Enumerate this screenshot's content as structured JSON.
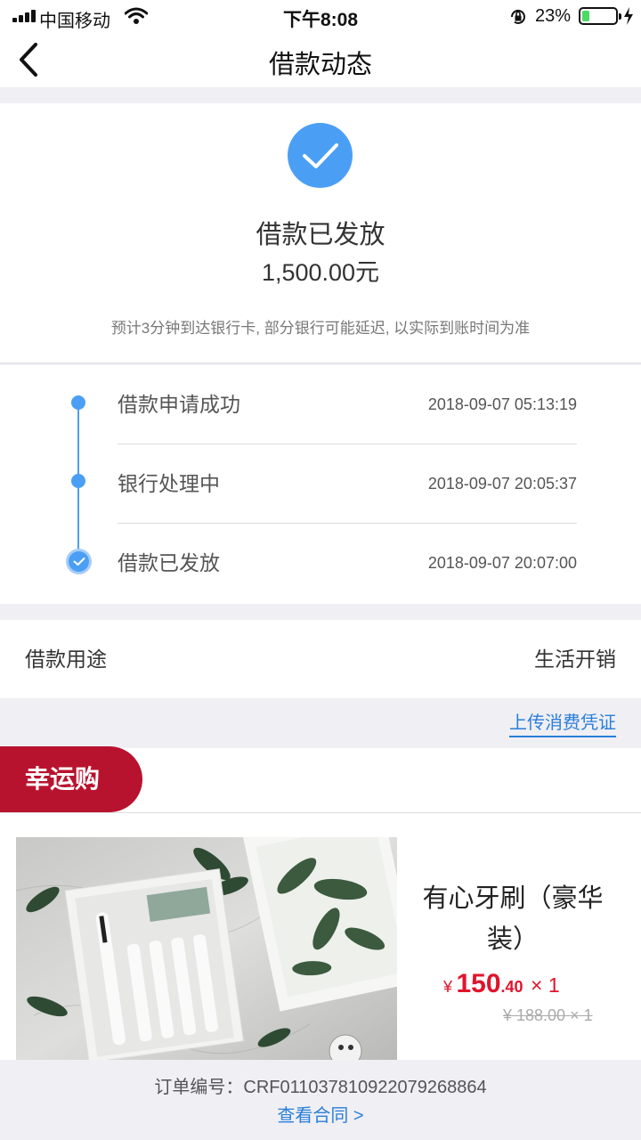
{
  "status_bar": {
    "carrier": "中国移动",
    "time": "下午8:08",
    "battery_percent": "23%",
    "battery_level": 0.23,
    "icons": [
      "signal-icon",
      "wifi-icon",
      "orientation-lock-icon",
      "battery-icon",
      "charging-bolt-icon"
    ]
  },
  "nav": {
    "title": "借款动态",
    "back_icon": "chevron-left-icon"
  },
  "hero": {
    "icon": "check-circle-icon",
    "status": "借款已发放",
    "amount": "1,500.00元",
    "note": "预计3分钟到达银行卡, 部分银行可能延迟, 以实际到账时间为准"
  },
  "timeline": {
    "steps": [
      {
        "label": "借款申请成功",
        "time": "2018-09-07 05:13:19"
      },
      {
        "label": "银行处理中",
        "time": "2018-09-07 20:05:37"
      },
      {
        "label": "借款已发放",
        "time": "2018-09-07 20:07:00"
      }
    ]
  },
  "purpose": {
    "label": "借款用途",
    "value": "生活开销"
  },
  "upload": {
    "label": "上传消费凭证"
  },
  "lucky": {
    "tag": "幸运购",
    "product_name": "有心牙刷（豪华装）",
    "price_symbol": "¥",
    "price_int": "150",
    "price_dec": ".40",
    "quantity": "× 1",
    "original_price": "¥ 188.00 × 1"
  },
  "footer": {
    "order_no": "订单编号：CRF011037810922079268864",
    "contract_link": "查看合同 >"
  },
  "colors": {
    "accent_blue": "#4a9ff5",
    "link_blue": "#2a7ed8",
    "brand_red": "#b8132e",
    "price_red": "#e0142b",
    "battery_green": "#4cd964"
  }
}
